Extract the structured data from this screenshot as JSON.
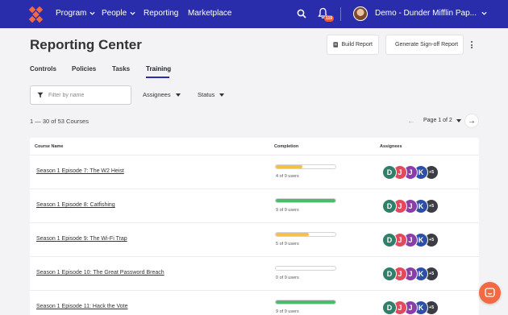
{
  "nav": {
    "items": [
      {
        "label": "Program",
        "has_dropdown": true
      },
      {
        "label": "People",
        "has_dropdown": true
      },
      {
        "label": "Reporting",
        "has_dropdown": false
      },
      {
        "label": "Marketplace",
        "has_dropdown": false
      }
    ],
    "notification_count": "119",
    "org_name": "Demo - Dunder Mifflin Pap...",
    "icons": [
      "logo-icon",
      "search-icon",
      "bell-icon",
      "avatar",
      "chevron-down-icon"
    ],
    "colors": {
      "nav_bg": "#2a2dab",
      "logo": "#f26a44",
      "badge": "#e85a3a"
    }
  },
  "header": {
    "title": "Reporting Center",
    "build_report_label": "Build Report",
    "sign_off_label": "Generate Sign-off Report"
  },
  "tabs": [
    {
      "label": "Controls",
      "active": false
    },
    {
      "label": "Policies",
      "active": false
    },
    {
      "label": "Tasks",
      "active": false
    },
    {
      "label": "Training",
      "active": true
    }
  ],
  "filters": {
    "search_placeholder": "Filter by name",
    "assignees_label": "Assignees",
    "status_label": "Status"
  },
  "pagination": {
    "count_text": "1 — 30 of 53 Courses",
    "page_text": "Page 1 of 2"
  },
  "table": {
    "columns": [
      "Course Name",
      "Completion",
      "Assignees"
    ],
    "rows": [
      {
        "course": "Season 1 Episode 7: The W2 Heist",
        "completion": "4 of 9 users",
        "fraction": 0.444,
        "color": "#f5c04a",
        "assignees": [
          "D",
          "J",
          "J",
          "K"
        ],
        "more": "+5"
      },
      {
        "course": "Season 1 Episode 8: Catfishing",
        "completion": "9 of 9 users",
        "fraction": 1.0,
        "color": "#4cbb6b",
        "assignees": [
          "D",
          "J",
          "J",
          "K"
        ],
        "more": "+5"
      },
      {
        "course": "Season 1 Episode 9: The Wi-Fi Trap",
        "completion": "5 of 9 users",
        "fraction": 0.556,
        "color": "#f5c04a",
        "assignees": [
          "D",
          "J",
          "J",
          "K"
        ],
        "more": "+5"
      },
      {
        "course": "Season 1 Episode 10: The Great Password Breach",
        "completion": "0 of 9 users",
        "fraction": 0.0,
        "color": "#f5c04a",
        "assignees": [
          "D",
          "J",
          "J",
          "K"
        ],
        "more": "+5"
      },
      {
        "course": "Season 1 Episode 11: Hack the Vote",
        "completion": "9 of 9 users",
        "fraction": 1.0,
        "color": "#4cbb6b",
        "assignees": [
          "D",
          "J",
          "J",
          "K"
        ],
        "more": "+5"
      }
    ],
    "avatar_colors": [
      "#2f7f6a",
      "#e24a5e",
      "#8a3fa8",
      "#2d4fa8",
      "#3c3c44"
    ]
  }
}
